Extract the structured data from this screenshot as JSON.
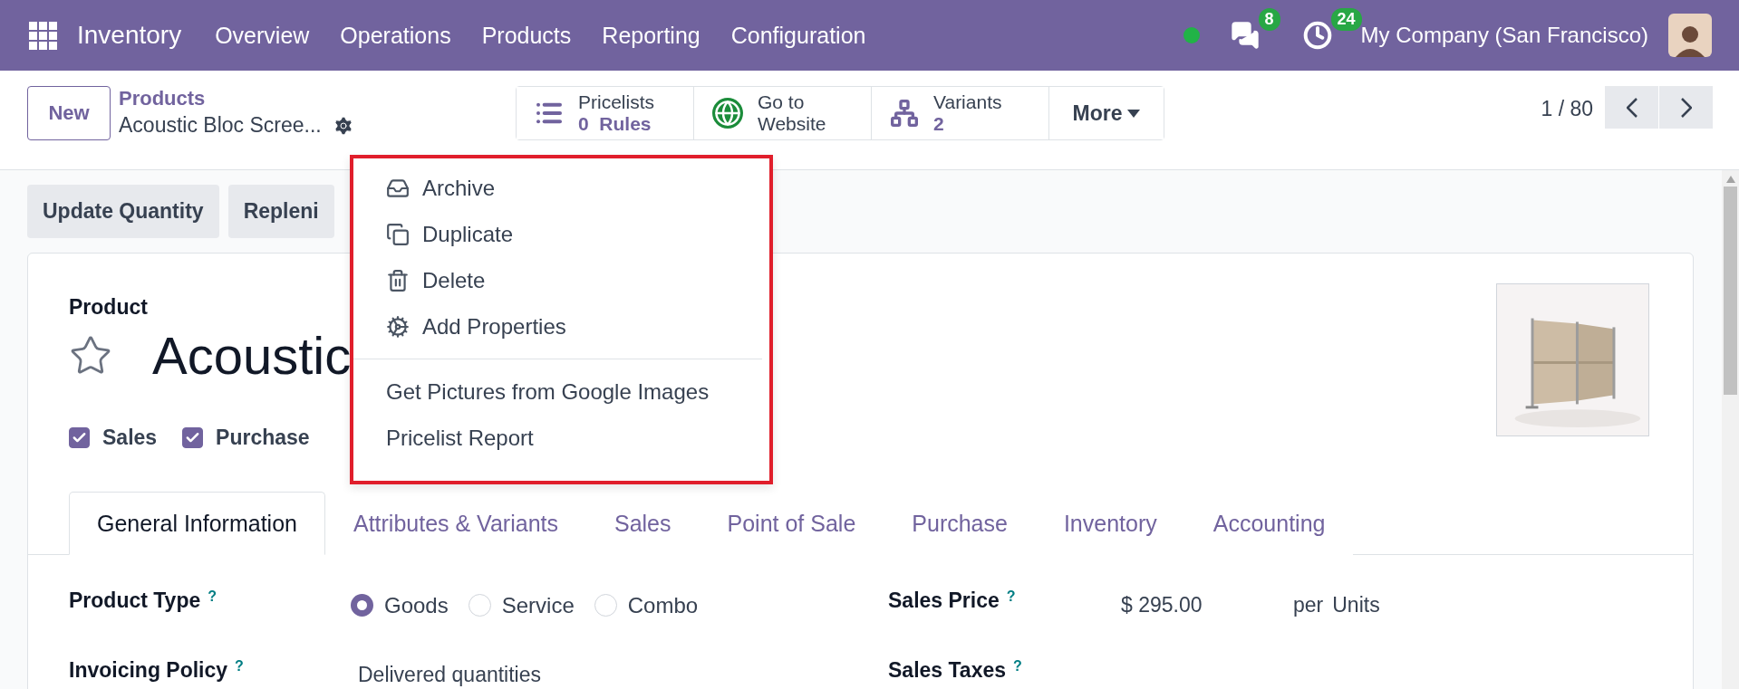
{
  "navbar": {
    "app_name": "Inventory",
    "menu": [
      "Overview",
      "Operations",
      "Products",
      "Reporting",
      "Configuration"
    ],
    "messages_count": "8",
    "activities_count": "24",
    "company": "My Company (San Francisco)"
  },
  "control_panel": {
    "new_button": "New",
    "breadcrumb": {
      "parent": "Products",
      "current": "Acoustic Bloc Scree..."
    },
    "smart_buttons": [
      {
        "kind": "pricelists",
        "line1": "Pricelists",
        "value": "0",
        "unit": "Rules"
      },
      {
        "kind": "website",
        "line1": "Go to",
        "line2": "Website"
      },
      {
        "kind": "variants",
        "line1": "Variants",
        "value": "2"
      }
    ],
    "more": "More",
    "pager": "1 / 80"
  },
  "action_menu": {
    "items": [
      {
        "kind": "archive",
        "label": "Archive"
      },
      {
        "kind": "duplicate",
        "label": "Duplicate"
      },
      {
        "kind": "delete",
        "label": "Delete"
      },
      {
        "kind": "properties",
        "label": "Add Properties"
      }
    ],
    "extra_items": [
      "Get Pictures from Google Images",
      "Pricelist Report"
    ]
  },
  "header_buttons": [
    "Update Quantity",
    "Repleni"
  ],
  "form": {
    "label": "Product",
    "favorite": false,
    "name": "Acoustic",
    "options": [
      {
        "label": "Sales",
        "checked": true
      },
      {
        "label": "Purchase",
        "checked": true
      }
    ],
    "tabs": [
      {
        "label": "General Information",
        "selected": true
      },
      {
        "label": "Attributes & Variants",
        "selected": false
      },
      {
        "label": "Sales",
        "selected": false
      },
      {
        "label": "Point of Sale",
        "selected": false
      },
      {
        "label": "Purchase",
        "selected": false
      },
      {
        "label": "Inventory",
        "selected": false
      },
      {
        "label": "Accounting",
        "selected": false
      }
    ],
    "fields": [
      {
        "label": "Product Type",
        "help": "?",
        "kind": "radio",
        "options": [
          {
            "label": "Goods",
            "selected": true
          },
          {
            "label": "Service",
            "selected": false
          },
          {
            "label": "Combo",
            "selected": false
          }
        ]
      },
      {
        "label": "Sales Price",
        "help": "?",
        "kind": "price",
        "value": "$ 295.00",
        "per": "per",
        "unit": "Units"
      },
      {
        "label": "Invoicing Policy",
        "help": "?",
        "kind": "text",
        "value": "Delivered quantities"
      },
      {
        "label": "Sales Taxes",
        "help": "?",
        "kind": "empty"
      }
    ]
  }
}
